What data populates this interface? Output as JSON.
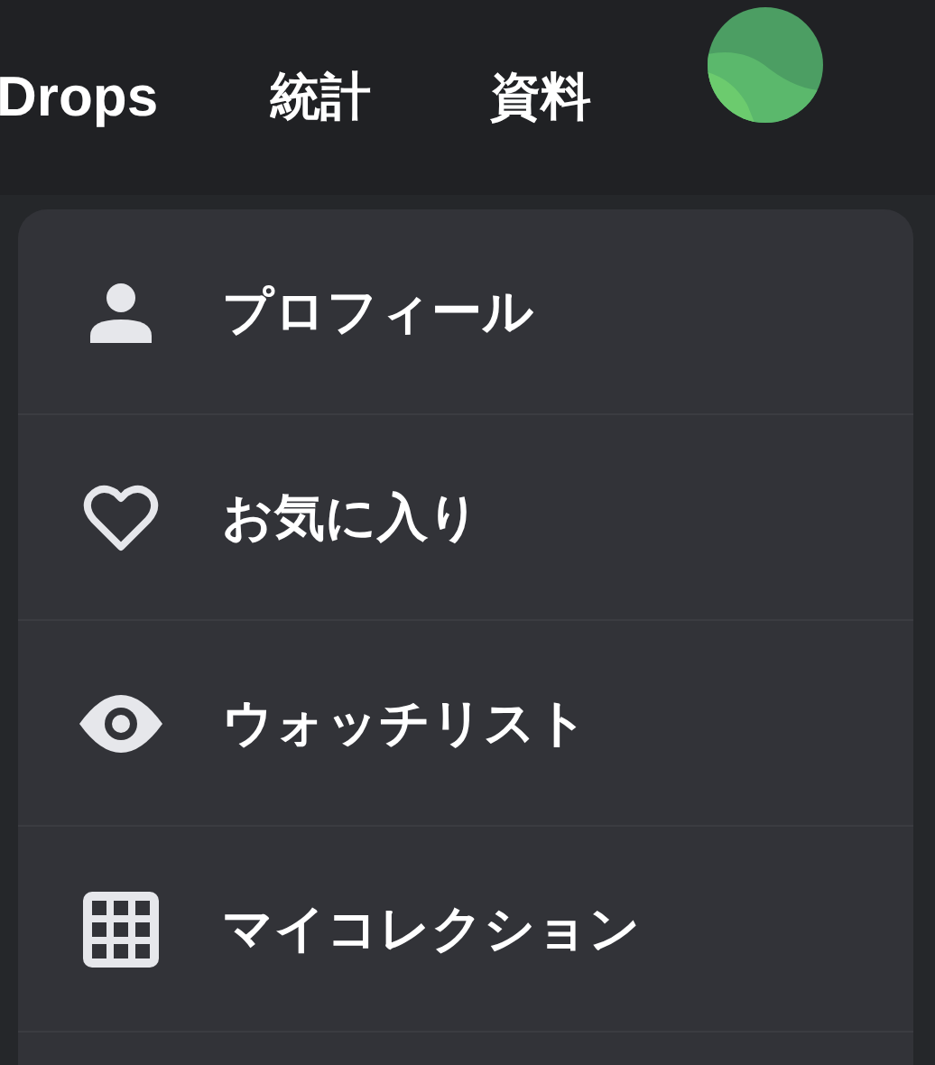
{
  "nav": {
    "items": [
      {
        "label": "Drops"
      },
      {
        "label": "統計"
      },
      {
        "label": "資料"
      }
    ]
  },
  "menu": {
    "items": [
      {
        "label": "プロフィール"
      },
      {
        "label": "お気に入り"
      },
      {
        "label": "ウォッチリスト"
      },
      {
        "label": "マイコレクション"
      }
    ]
  }
}
